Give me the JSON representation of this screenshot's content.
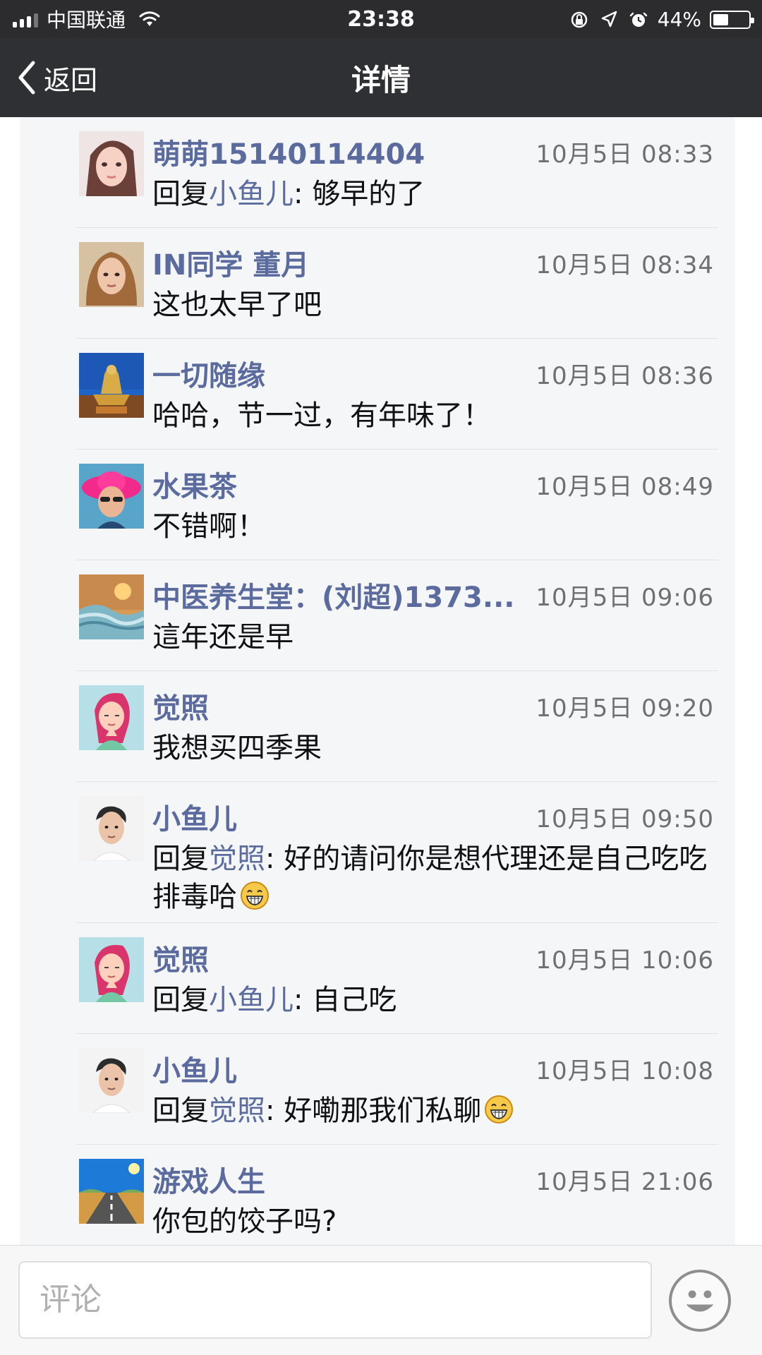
{
  "status_bar": {
    "carrier": "中国联通",
    "time": "23:38",
    "battery": "44%",
    "battery_level": 0.44
  },
  "nav": {
    "back_label": "返回",
    "title": "详情"
  },
  "comments": [
    {
      "name": "萌萌15140114404",
      "time": "10月5日 08:33",
      "prefix": "回复",
      "mention": "小鱼儿",
      "text": ": 够早的了",
      "avatar": "avatar-girl-1"
    },
    {
      "name": "IN同学 董月",
      "time": "10月5日 08:34",
      "prefix": "",
      "mention": "",
      "text": "这也太早了吧",
      "avatar": "avatar-girl-2"
    },
    {
      "name": "一切随缘",
      "time": "10月5日 08:36",
      "prefix": "",
      "mention": "",
      "text": "哈哈，节一过，有年味了！",
      "avatar": "avatar-buddha"
    },
    {
      "name": "水果茶",
      "time": "10月5日 08:49",
      "prefix": "",
      "mention": "",
      "text": "不错啊！",
      "avatar": "avatar-pink-hat"
    },
    {
      "name": "中医养生堂：(刘超)1373...",
      "time": "10月5日 09:06",
      "prefix": "",
      "mention": "",
      "text": "這年还是早",
      "avatar": "avatar-landscape"
    },
    {
      "name": "觉照",
      "time": "10月5日 09:20",
      "prefix": "",
      "mention": "",
      "text": "我想买四季果",
      "avatar": "avatar-anime"
    },
    {
      "name": "小鱼儿",
      "time": "10月5日 09:50",
      "prefix": "回复",
      "mention": "觉照",
      "text": ": 好的请问你是想代理还是自己吃吃排毒哈",
      "emoji": "grin",
      "avatar": "avatar-man"
    },
    {
      "name": "觉照",
      "time": "10月5日 10:06",
      "prefix": "回复",
      "mention": "小鱼儿",
      "text": ": 自己吃",
      "avatar": "avatar-anime"
    },
    {
      "name": "小鱼儿",
      "time": "10月5日 10:08",
      "prefix": "回复",
      "mention": "觉照",
      "text": ": 好嘞那我们私聊",
      "emoji": "grin",
      "avatar": "avatar-man"
    },
    {
      "name": "游戏人生",
      "time": "10月5日 21:06",
      "prefix": "",
      "mention": "",
      "text": "你包的饺子吗?",
      "avatar": "avatar-road"
    }
  ],
  "comment_box": {
    "placeholder": "评论"
  },
  "colors": {
    "nav_bg": "#2f3033",
    "name_blue": "#5b6b9e",
    "feed_bg": "#f5f6f8"
  },
  "icons": {
    "back": "chevron-left-icon",
    "emoji": "smile-face-icon",
    "inline_emoji": "grin-emoji-icon"
  }
}
